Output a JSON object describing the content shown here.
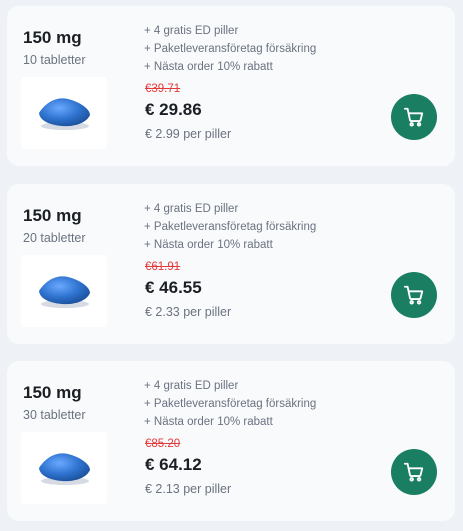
{
  "products": [
    {
      "dose": "150 mg",
      "count": "10 tabletter",
      "features": [
        "+ 4 gratis ED piller",
        "+ Paketleveransföretag försäkring",
        "+ Nästa order 10% rabatt"
      ],
      "old_price": "€39.71",
      "price": "€ 29.86",
      "unit_price": "€ 2.99 per piller",
      "cart_icon": "shopping-cart-icon"
    },
    {
      "dose": "150 mg",
      "count": "20 tabletter",
      "features": [
        "+ 4 gratis ED piller",
        "+ Paketleveransföretag försäkring",
        "+ Nästa order 10% rabatt"
      ],
      "old_price": "€61.91",
      "price": "€ 46.55",
      "unit_price": "€ 2.33 per piller",
      "cart_icon": "shopping-cart-icon"
    },
    {
      "dose": "150 mg",
      "count": "30 tabletter",
      "features": [
        "+ 4 gratis ED piller",
        "+ Paketleveransföretag försäkring",
        "+ Nästa order 10% rabatt"
      ],
      "old_price": "€85.20",
      "price": "€ 64.12",
      "unit_price": "€ 2.13 per piller",
      "cart_icon": "shopping-cart-icon"
    }
  ],
  "colors": {
    "accent": "#1a7f62",
    "strike": "#e23b3b",
    "pill": "#2f74d0"
  }
}
